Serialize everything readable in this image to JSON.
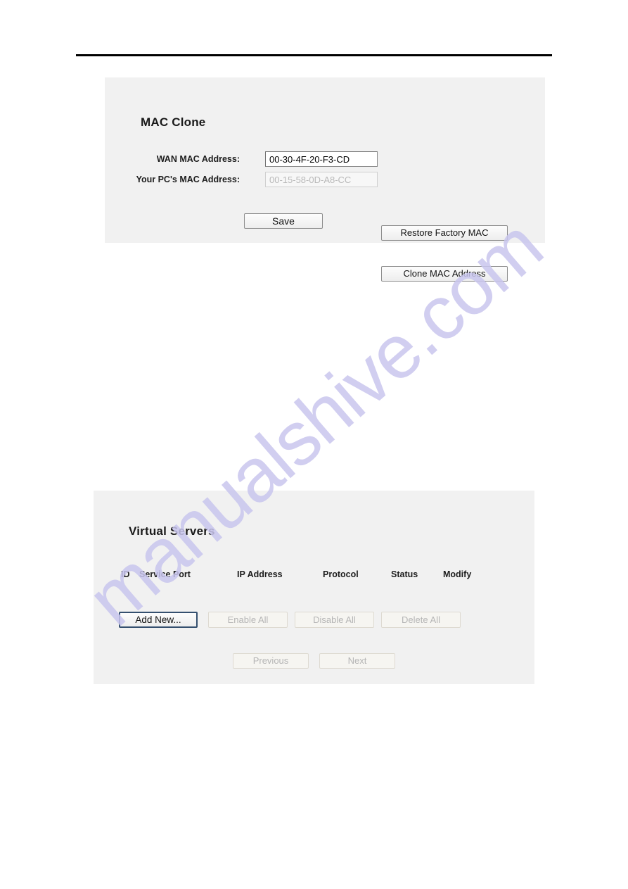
{
  "page": {
    "watermark_text": "manualshive.com",
    "watermark_color": "#c9c6ee",
    "background_color": "#ffffff",
    "panel_background_color": "#f1f1f1"
  },
  "mac_clone": {
    "title": "MAC Clone",
    "fields": [
      {
        "label": "WAN MAC Address:",
        "value": "00-30-4F-20-F3-CD",
        "disabled": false,
        "button": "Restore Factory MAC"
      },
      {
        "label": "Your PC's MAC Address:",
        "value": "00-15-58-0D-A8-CC",
        "disabled": true,
        "button": "Clone MAC Address"
      }
    ],
    "save_label": "Save"
  },
  "virtual_servers": {
    "title": "Virtual Servers",
    "columns": [
      "ID",
      "Service Port",
      "IP Address",
      "Protocol",
      "Status",
      "Modify"
    ],
    "rows": [],
    "actions": {
      "add_new": "Add New...",
      "enable_all": "Enable All",
      "disable_all": "Disable All",
      "delete_all": "Delete All"
    },
    "pagination": {
      "previous": "Previous",
      "next": "Next"
    }
  }
}
